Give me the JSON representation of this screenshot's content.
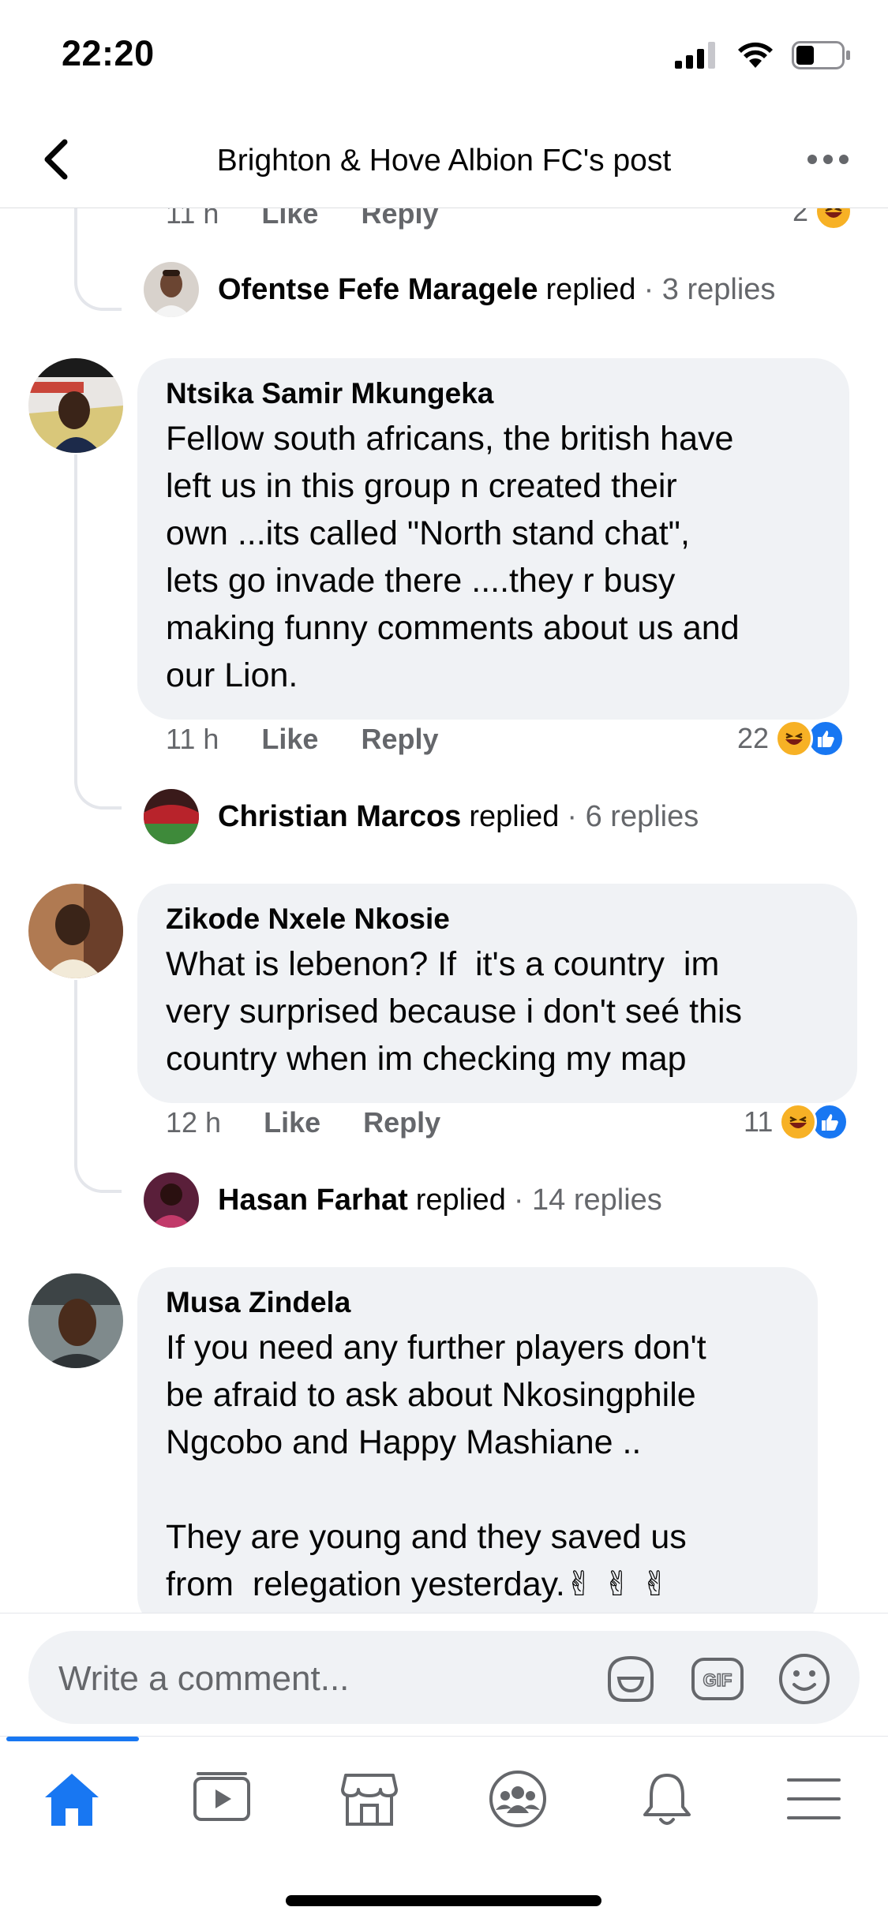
{
  "status": {
    "time": "22:20"
  },
  "header": {
    "title": "Brighton & Hove Albion FC's post"
  },
  "top_partial": {
    "time": "11 h",
    "like": "Like",
    "reply": "Reply",
    "reactions": "2"
  },
  "replies": [
    {
      "name": "Ofentse Fefe Maragele",
      "verb": "replied",
      "count": "· 3 replies"
    },
    {
      "name": "Christian Marcos",
      "verb": "replied",
      "count": "· 6 replies"
    },
    {
      "name": "Hasan Farhat",
      "verb": "replied",
      "count": "· 14 replies"
    }
  ],
  "comments": [
    {
      "author": "Ntsika Samir Mkungeka",
      "text": "Fellow south africans, the british have\nleft us in this group n created their\nown ...its called \"North stand chat\",\nlets go invade there ....they r busy\nmaking funny comments about us and\nour Lion.",
      "time": "11 h",
      "like": "Like",
      "reply": "Reply",
      "reactions": "22"
    },
    {
      "author": "Zikode Nxele Nkosie",
      "text": "What is lebenon? If  it's a country  im\nvery surprised because i don't seé this\ncountry when im checking my map",
      "time": "12 h",
      "like": "Like",
      "reply": "Reply",
      "reactions": "11"
    },
    {
      "author": "Musa Zindela",
      "text": "If you need any further players don't\nbe afraid to ask about Nkosingphile\nNgcobo and Happy Mashiane ..\n\nThey are young and they saved us\nfrom  relegation yesterday.✌ ✌ ✌"
    }
  ],
  "composer": {
    "placeholder": "Write a comment..."
  },
  "colors": {
    "accent": "#1877f2",
    "bubble": "#f0f2f5",
    "muted": "#65676b"
  }
}
